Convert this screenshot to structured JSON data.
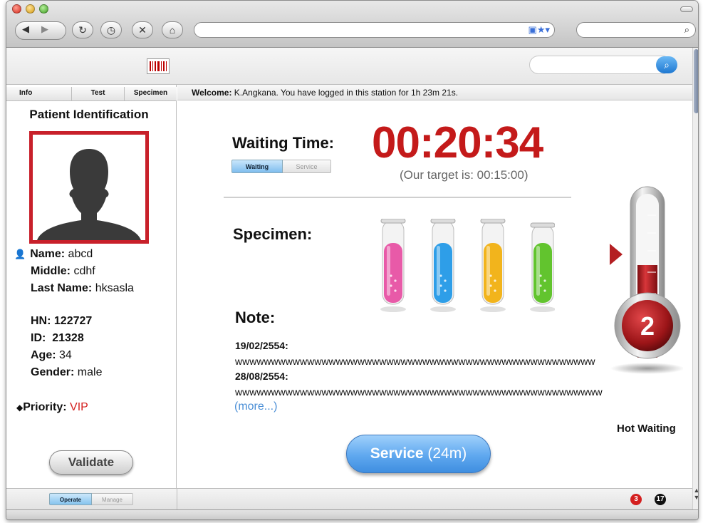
{
  "browser": {
    "nav": {
      "back": "◀",
      "forward": "▶",
      "reload": "↻",
      "history": "◷",
      "stop": "✕",
      "home": "⌂"
    },
    "url_icons": "▣★▾",
    "search_glass": "⌕"
  },
  "toolbar": {
    "search_button_icon": "⌕"
  },
  "left_panel": {
    "tabs": [
      "Info",
      "Test",
      "Specimen"
    ],
    "title": "Patient Identification",
    "fields": {
      "name_label": "Name:",
      "name": "abcd",
      "middle_label": "Middle:",
      "middle": "cdhf",
      "last_label": "Last Name:",
      "last": "hksasla",
      "hn_label": "HN:",
      "hn": "122727",
      "id_label": "ID:",
      "id": "21328",
      "age_label": "Age:",
      "age": "34",
      "gender_label": "Gender:",
      "gender": "male",
      "priority_label": "Priority:",
      "priority": "VIP"
    },
    "validate_label": "Validate"
  },
  "footer": {
    "operate_label": "Operate",
    "manage_label": "Manage",
    "badge_red": "3",
    "badge_black": "17"
  },
  "welcome": {
    "prefix": "Welcome:",
    "message": " K.Angkana. You have logged in this station for 1h 23m 21s."
  },
  "waiting": {
    "label": "Waiting Time:",
    "toggle_waiting": "Waiting",
    "toggle_service": "Service",
    "timer": "00:20:34",
    "target": "(Our target is: 00:15:00)"
  },
  "specimen": {
    "label": "Specimen:",
    "tube_colors": [
      "#e85aa8",
      "#2e9ee8",
      "#f2b41c",
      "#62c42e"
    ]
  },
  "notes": {
    "label": "Note:",
    "items": [
      {
        "date": "19/02/2554:",
        "text": "wwwwwwwwwwwwwwwwwwwwwwwwwwwwwwwwwwwwwwwwwwwwwwwwww"
      },
      {
        "date": "28/08/2554:",
        "text": "wwwwwwwwwwwwwwwwwwwwwwwwwwwwwwwwwwwwwwwwwwwwwwwwwww"
      }
    ],
    "more": "(more...)"
  },
  "service_button": {
    "label": "Service",
    "duration": " (24m)"
  },
  "thermometer": {
    "level": 2,
    "label": "Hot Waiting",
    "accent": "#b41f22"
  }
}
